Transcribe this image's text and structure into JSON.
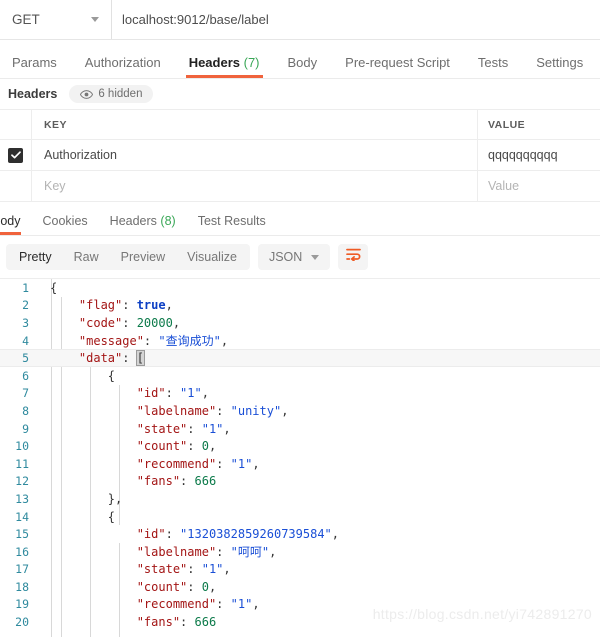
{
  "request_bar": {
    "method": "GET",
    "method_icon": "chevron-down-icon",
    "url": "localhost:9012/base/label"
  },
  "request_tabs": [
    {
      "label": "Params",
      "count": "",
      "active": false
    },
    {
      "label": "Authorization",
      "count": "",
      "active": false
    },
    {
      "label": "Headers",
      "count": "(7)",
      "active": true
    },
    {
      "label": "Body",
      "count": "",
      "active": false
    },
    {
      "label": "Pre-request Script",
      "count": "",
      "active": false
    },
    {
      "label": "Tests",
      "count": "",
      "active": false
    },
    {
      "label": "Settings",
      "count": "",
      "active": false
    }
  ],
  "headers_section": {
    "title": "Headers",
    "hidden_badge": "6 hidden",
    "hidden_icon": "eye-icon",
    "columns": {
      "key": "KEY",
      "value": "VALUE"
    },
    "rows": [
      {
        "checked": true,
        "key": "Authorization",
        "value": "qqqqqqqqqq"
      }
    ],
    "new_row": {
      "key_placeholder": "Key",
      "value_placeholder": "Value"
    }
  },
  "response_tabs": [
    {
      "label": "Body",
      "count": "",
      "active": true
    },
    {
      "label": "Cookies",
      "count": "",
      "active": false
    },
    {
      "label": "Headers",
      "count": "(8)",
      "active": false
    },
    {
      "label": "Test Results",
      "count": "",
      "active": false
    }
  ],
  "body_toolbar": {
    "views": [
      {
        "label": "Pretty",
        "active": true
      },
      {
        "label": "Raw",
        "active": false
      },
      {
        "label": "Preview",
        "active": false
      },
      {
        "label": "Visualize",
        "active": false
      }
    ],
    "format_selected": "JSON",
    "format_caret_icon": "chevron-down-icon",
    "wrap_icon": "text-wrap-icon",
    "accent_color": "#ef5b25"
  },
  "code_lines": [
    {
      "n": "1",
      "tokens": [
        {
          "t": "{",
          "c": "p"
        }
      ]
    },
    {
      "n": "2",
      "tokens": [
        {
          "t": "    \"flag\"",
          "c": "k"
        },
        {
          "t": ": ",
          "c": "p"
        },
        {
          "t": "true",
          "c": "b"
        },
        {
          "t": ",",
          "c": "p"
        }
      ]
    },
    {
      "n": "3",
      "tokens": [
        {
          "t": "    \"code\"",
          "c": "k"
        },
        {
          "t": ": ",
          "c": "p"
        },
        {
          "t": "20000",
          "c": "n"
        },
        {
          "t": ",",
          "c": "p"
        }
      ]
    },
    {
      "n": "4",
      "tokens": [
        {
          "t": "    \"message\"",
          "c": "k"
        },
        {
          "t": ": ",
          "c": "p"
        },
        {
          "t": "\"查询成功\"",
          "c": "s"
        },
        {
          "t": ",",
          "c": "p"
        }
      ]
    },
    {
      "n": "5",
      "tokens": [
        {
          "t": "    \"data\"",
          "c": "k"
        },
        {
          "t": ": ",
          "c": "p"
        },
        {
          "t": "[",
          "c": "cursor"
        }
      ],
      "highlight": true
    },
    {
      "n": "6",
      "tokens": [
        {
          "t": "        {",
          "c": "p"
        }
      ]
    },
    {
      "n": "7",
      "tokens": [
        {
          "t": "            \"id\"",
          "c": "k"
        },
        {
          "t": ": ",
          "c": "p"
        },
        {
          "t": "\"1\"",
          "c": "s"
        },
        {
          "t": ",",
          "c": "p"
        }
      ]
    },
    {
      "n": "8",
      "tokens": [
        {
          "t": "            \"labelname\"",
          "c": "k"
        },
        {
          "t": ": ",
          "c": "p"
        },
        {
          "t": "\"unity\"",
          "c": "s"
        },
        {
          "t": ",",
          "c": "p"
        }
      ]
    },
    {
      "n": "9",
      "tokens": [
        {
          "t": "            \"state\"",
          "c": "k"
        },
        {
          "t": ": ",
          "c": "p"
        },
        {
          "t": "\"1\"",
          "c": "s"
        },
        {
          "t": ",",
          "c": "p"
        }
      ]
    },
    {
      "n": "10",
      "tokens": [
        {
          "t": "            \"count\"",
          "c": "k"
        },
        {
          "t": ": ",
          "c": "p"
        },
        {
          "t": "0",
          "c": "n"
        },
        {
          "t": ",",
          "c": "p"
        }
      ]
    },
    {
      "n": "11",
      "tokens": [
        {
          "t": "            \"recommend\"",
          "c": "k"
        },
        {
          "t": ": ",
          "c": "p"
        },
        {
          "t": "\"1\"",
          "c": "s"
        },
        {
          "t": ",",
          "c": "p"
        }
      ]
    },
    {
      "n": "12",
      "tokens": [
        {
          "t": "            \"fans\"",
          "c": "k"
        },
        {
          "t": ": ",
          "c": "p"
        },
        {
          "t": "666",
          "c": "n"
        }
      ]
    },
    {
      "n": "13",
      "tokens": [
        {
          "t": "        },",
          "c": "p"
        }
      ]
    },
    {
      "n": "14",
      "tokens": [
        {
          "t": "        {",
          "c": "p"
        }
      ]
    },
    {
      "n": "15",
      "tokens": [
        {
          "t": "            \"id\"",
          "c": "k"
        },
        {
          "t": ": ",
          "c": "p"
        },
        {
          "t": "\"1320382859260739584\"",
          "c": "s"
        },
        {
          "t": ",",
          "c": "p"
        }
      ]
    },
    {
      "n": "16",
      "tokens": [
        {
          "t": "            \"labelname\"",
          "c": "k"
        },
        {
          "t": ": ",
          "c": "p"
        },
        {
          "t": "\"呵呵\"",
          "c": "s"
        },
        {
          "t": ",",
          "c": "p"
        }
      ]
    },
    {
      "n": "17",
      "tokens": [
        {
          "t": "            \"state\"",
          "c": "k"
        },
        {
          "t": ": ",
          "c": "p"
        },
        {
          "t": "\"1\"",
          "c": "s"
        },
        {
          "t": ",",
          "c": "p"
        }
      ]
    },
    {
      "n": "18",
      "tokens": [
        {
          "t": "            \"count\"",
          "c": "k"
        },
        {
          "t": ": ",
          "c": "p"
        },
        {
          "t": "0",
          "c": "n"
        },
        {
          "t": ",",
          "c": "p"
        }
      ]
    },
    {
      "n": "19",
      "tokens": [
        {
          "t": "            \"recommend\"",
          "c": "k"
        },
        {
          "t": ": ",
          "c": "p"
        },
        {
          "t": "\"1\"",
          "c": "s"
        },
        {
          "t": ",",
          "c": "p"
        }
      ]
    },
    {
      "n": "20",
      "tokens": [
        {
          "t": "            \"fans\"",
          "c": "k"
        },
        {
          "t": ": ",
          "c": "p"
        },
        {
          "t": "666",
          "c": "n"
        }
      ]
    }
  ],
  "watermark": "https://blog.csdn.net/yi742891270"
}
